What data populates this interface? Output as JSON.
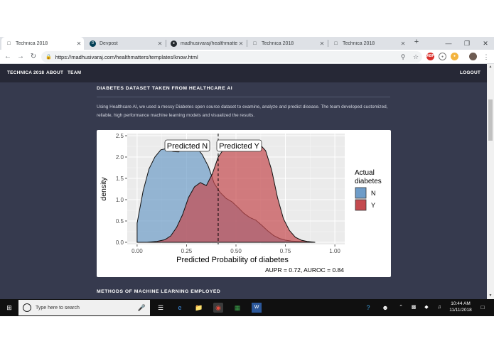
{
  "browser": {
    "tabs": [
      {
        "label": "Technica 2018",
        "active": true
      },
      {
        "label": "Devpost",
        "active": false
      },
      {
        "label": "madhusivaraj/healthmatters",
        "active": false
      },
      {
        "label": "Technica 2018",
        "active": false
      },
      {
        "label": "Technica 2018",
        "active": false
      }
    ],
    "url": "https://madhusivaraj.com/healthmatters/templates/know.html",
    "extensions": [
      "ABP"
    ]
  },
  "site": {
    "nav": {
      "brand": "TECHNICA 2018",
      "about": "ABOUT",
      "team": "TEAM",
      "logout": "LOGOUT"
    },
    "section1_title": "DIABETES DATASET TAKEN FROM HEALTHCARE AI",
    "section1_text": "Using Healthcare AI, we used a messy Diabetes open source dataset to examine, analyze and predict disease. The team developed customized, reliable, high performance machine learning models and visualized the results.",
    "section2_title": "METHODS OF MACHINE LEARNING EMPLOYED"
  },
  "chart_data": {
    "type": "area",
    "xlabel": "Predicted Probability of diabetes",
    "ylabel": "density",
    "xlim": [
      -0.05,
      1.05
    ],
    "ylim": [
      -0.05,
      2.55
    ],
    "xticks": [
      0.0,
      0.25,
      0.5,
      0.75,
      1.0
    ],
    "xtick_labels": [
      "0.00",
      "0.25",
      "0.50",
      "0.75",
      "1.00"
    ],
    "yticks": [
      0.0,
      0.5,
      1.0,
      1.5,
      2.0,
      2.5
    ],
    "ytick_labels": [
      "0.0",
      "0.5",
      "1.0",
      "1.5",
      "2.0",
      "2.5"
    ],
    "threshold": 0.41,
    "annotation_left": "Predicted N",
    "annotation_right": "Predicted Y",
    "caption": "AUPR = 0.72, AUROC = 0.84",
    "legend": {
      "title": "Actual diabetes",
      "title_line1": "Actual",
      "title_line2": "diabetes",
      "position": "right"
    },
    "grid": true,
    "series": [
      {
        "name": "N",
        "color": "#6e9cc8",
        "x": [
          0.0,
          0.0,
          0.03,
          0.06,
          0.09,
          0.12,
          0.15,
          0.18,
          0.21,
          0.24,
          0.27,
          0.3,
          0.33,
          0.36,
          0.39,
          0.42,
          0.45,
          0.48,
          0.51,
          0.54,
          0.57,
          0.6,
          0.63,
          0.66,
          0.69,
          0.72,
          0.75,
          0.78,
          0.81,
          0.85,
          0.9
        ],
        "y": [
          0.0,
          0.45,
          1.2,
          1.72,
          2.0,
          2.17,
          2.2,
          2.13,
          2.12,
          2.22,
          2.27,
          2.23,
          2.05,
          1.78,
          1.38,
          1.17,
          1.03,
          0.95,
          0.82,
          0.68,
          0.58,
          0.52,
          0.4,
          0.27,
          0.16,
          0.09,
          0.05,
          0.03,
          0.02,
          0.01,
          0.0
        ]
      },
      {
        "name": "Y",
        "color": "#c44a4f",
        "x": [
          0.0,
          0.05,
          0.1,
          0.14,
          0.17,
          0.2,
          0.23,
          0.26,
          0.29,
          0.32,
          0.35,
          0.38,
          0.41,
          0.44,
          0.47,
          0.5,
          0.53,
          0.56,
          0.59,
          0.62,
          0.65,
          0.68,
          0.71,
          0.74,
          0.77,
          0.8,
          0.83,
          0.86,
          0.9
        ],
        "y": [
          0.0,
          0.0,
          0.02,
          0.06,
          0.15,
          0.35,
          0.65,
          1.05,
          1.3,
          1.4,
          1.33,
          1.6,
          2.0,
          2.2,
          2.32,
          2.32,
          2.32,
          2.3,
          2.32,
          2.3,
          2.15,
          1.7,
          1.05,
          0.55,
          0.28,
          0.12,
          0.05,
          0.02,
          0.0
        ]
      }
    ]
  },
  "taskbar": {
    "search_placeholder": "Type here to search",
    "time": "10:44 AM",
    "date": "11/11/2018"
  }
}
